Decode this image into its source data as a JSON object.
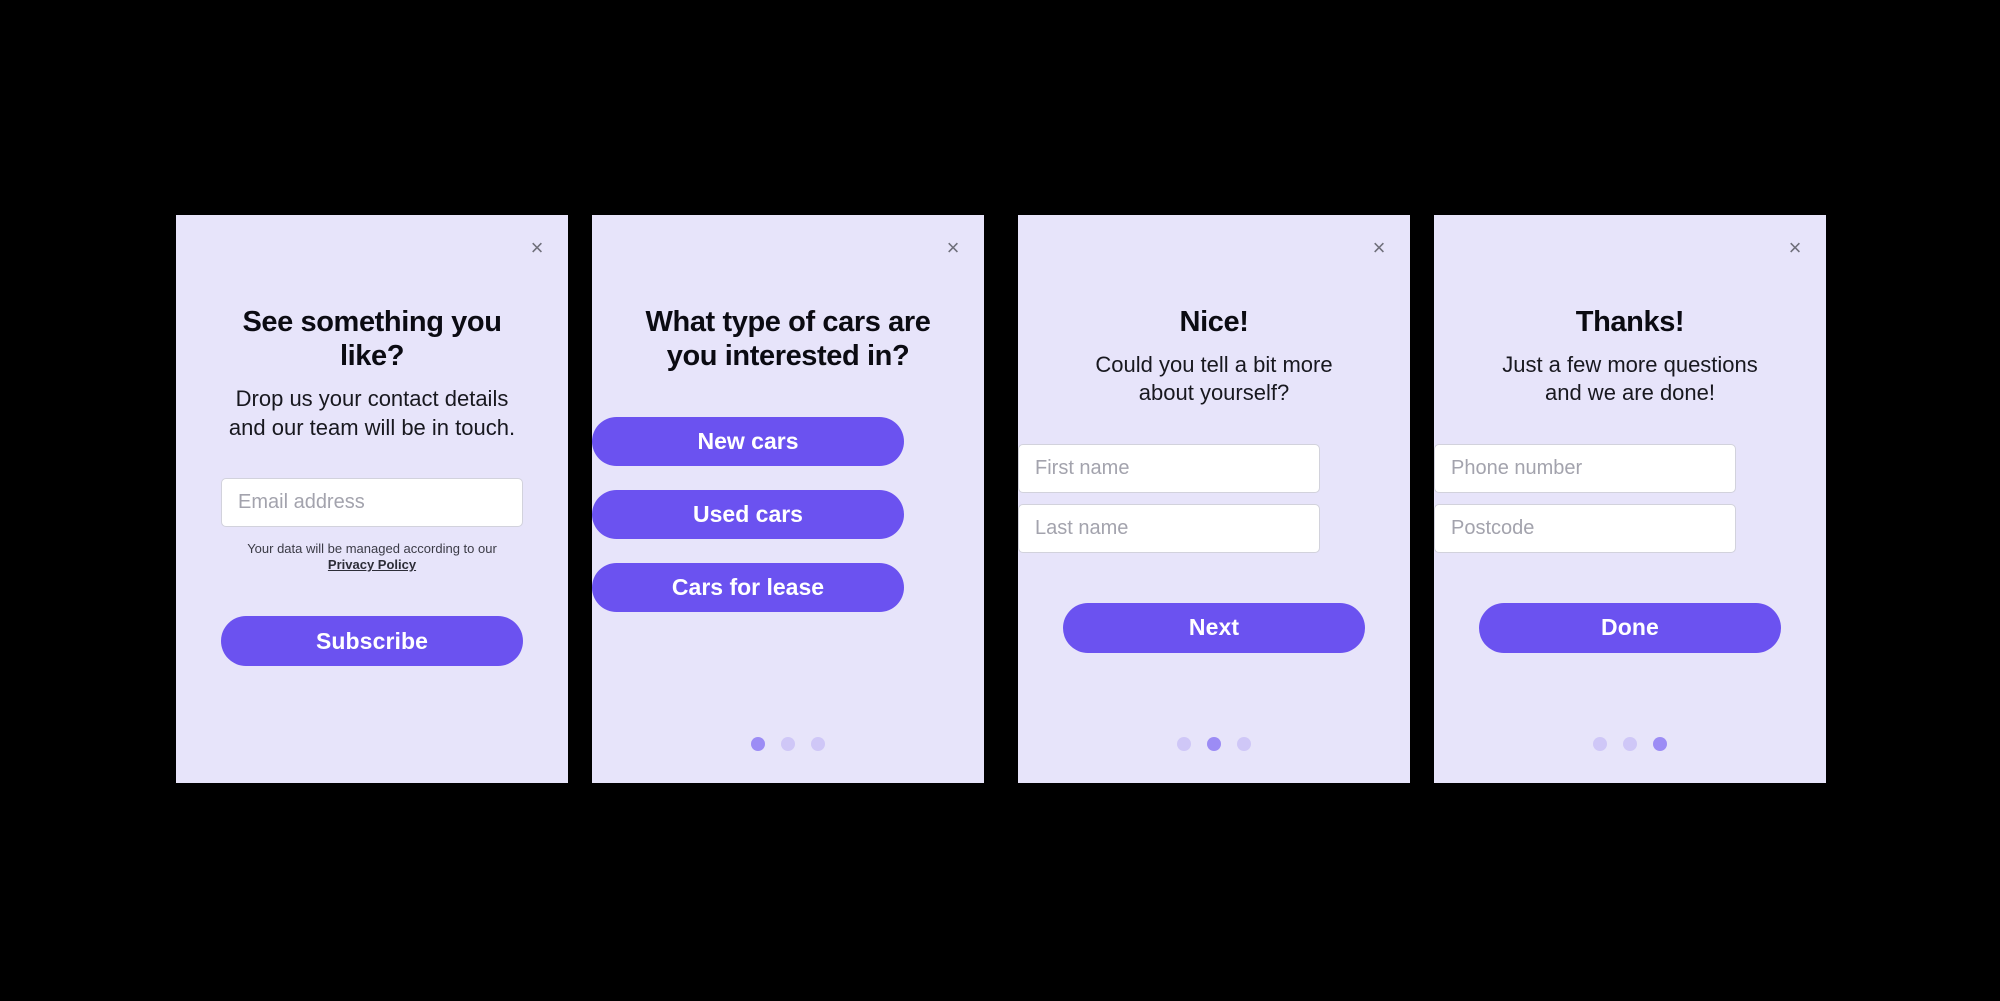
{
  "theme": {
    "page_background": "#000000",
    "card_background": "#e7e4fa",
    "card_shadow": "#e9e9e9",
    "accent": "#6b52f0",
    "input_background": "#ffffff",
    "input_border": "#d2d2dc",
    "placeholder_color": "#a3a3ad",
    "dot_inactive": "#cfc7f7",
    "dot_active": "#9c8cf5",
    "heading_color": "#0b0b12",
    "close_icon_color": "#6f6f7a"
  },
  "close_icon_glyph": "×",
  "cards": [
    {
      "id": "newsletter-signup",
      "title": "See something you like?",
      "subtitle": "Drop us your contact details\nand our team will be in touch.",
      "subtitle_line1": "Drop us your contact details",
      "subtitle_line2": "and our team will be in touch.",
      "fields": [
        {
          "name": "email",
          "placeholder": "Email address",
          "value": ""
        }
      ],
      "legal_text": "Your data will be managed according to our",
      "legal_link": "Privacy Policy",
      "cta_label": "Subscribe",
      "has_dots": false
    },
    {
      "id": "car-type-question",
      "title_line1": "What type of cars are",
      "title_line2": "you interested in?",
      "title": "What type of cars are you interested in?",
      "options": [
        {
          "label": "New cars"
        },
        {
          "label": "Used cars"
        },
        {
          "label": "Cars for lease"
        }
      ],
      "has_dots": true,
      "dots_total": 3,
      "dots_active_index": 0
    },
    {
      "id": "personal-details",
      "title": "Nice!",
      "subtitle_line1": "Could you tell a bit more",
      "subtitle_line2": "about yourself?",
      "subtitle": "Could you tell a bit more about yourself?",
      "fields": [
        {
          "name": "first-name",
          "placeholder": "First name",
          "value": ""
        },
        {
          "name": "last-name",
          "placeholder": "Last name",
          "value": ""
        }
      ],
      "cta_label": "Next",
      "has_dots": true,
      "dots_total": 3,
      "dots_active_index": 1
    },
    {
      "id": "contact-details",
      "title": "Thanks!",
      "subtitle_line1": "Just a few more questions",
      "subtitle_line2": "and we are done!",
      "subtitle": "Just a few more questions and we are done!",
      "fields": [
        {
          "name": "phone-number",
          "placeholder": "Phone number",
          "value": ""
        },
        {
          "name": "postcode",
          "placeholder": "Postcode",
          "value": ""
        }
      ],
      "cta_label": "Done",
      "has_dots": true,
      "dots_total": 3,
      "dots_active_index": 2
    }
  ]
}
